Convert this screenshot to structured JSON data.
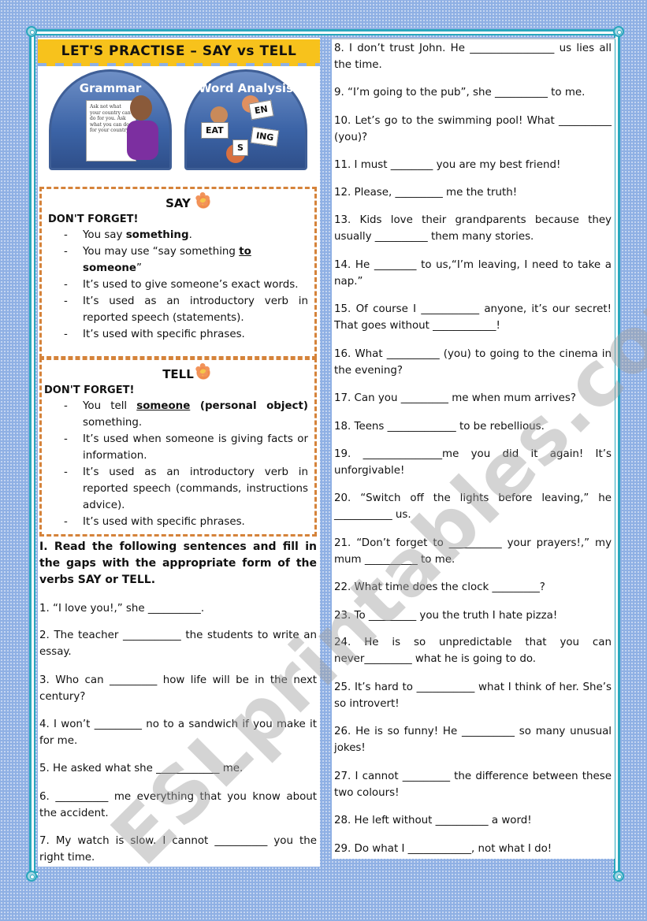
{
  "title": "LET'S PRACTISE – SAY vs TELL",
  "images": {
    "grammar_label": "Grammar",
    "grammar_card_text": "Ask not what your country can do for you. Ask what you can do for your country.",
    "word_analysis_label": "Word Analysis",
    "word_cards": [
      "EAT",
      "ING",
      "EN",
      "S"
    ]
  },
  "say_box": {
    "heading": "SAY",
    "reminder": "DON'T FORGET!",
    "rules": [
      {
        "pre": "You say ",
        "bold": "something",
        "post": "."
      },
      {
        "pre": "You may use “say something ",
        "underline_bold": "to",
        "bold": " someone",
        "post": "”"
      },
      {
        "pre": "It’s used to give someone’s exact words."
      },
      {
        "pre": "It’s used as an introductory verb in reported speech (statements)."
      },
      {
        "pre": "It’s used with specific phrases."
      }
    ]
  },
  "tell_box": {
    "heading": "TELL",
    "reminder": "DON'T FORGET!",
    "rules": [
      {
        "pre": "You tell ",
        "underline_bold": "someone",
        "bold": " (personal object)",
        "post": " something."
      },
      {
        "pre": "It’s used when someone is giving facts or information."
      },
      {
        "pre": "It’s used as an introductory verb in reported speech (commands, instructions advice)."
      },
      {
        "pre": "It’s used with specific phrases."
      }
    ]
  },
  "instructions": "I. Read the following sentences and fill in the gaps with the appropriate form of the verbs SAY or TELL.",
  "questions": [
    "1. “I love you!,” she __________.",
    "2. The teacher ___________ the students to write an essay.",
    "3. Who can _________ how life will be in the next century?",
    "4. I won’t _________ no to a sandwich if you make it for me.",
    "5. He asked what she ____________ me.",
    "6. __________ me everything that you know about the accident.",
    "7. My watch is slow. I cannot __________ you the right time.",
    "8. I don’t trust John. He ________________ us lies all the time.",
    "9. “I’m going to the pub”, she __________ to me.",
    "10. Let’s go to the swimming pool! What __________ (you)?",
    "11. I must ________ you are my best friend!",
    "12. Please, _________ me the truth!",
    "13. Kids love their grandparents because they usually __________ them many stories.",
    "14. He ________ to us,“I’m leaving, I need to take a nap.”",
    "15. Of course I ___________ anyone, it’s our secret! That goes without ____________!",
    "16. What __________ (you) to going to the cinema in the evening?",
    "17. Can you _________ me when mum arrives?",
    "18. Teens _____________ to be rebellious.",
    "19. _______________me you did it again! It’s unforgivable!",
    "20. “Switch off the lights before leaving,” he ___________ us.",
    "21. “Don’t forget to __________ your prayers!,” my mum __________ to me.",
    "22. What time does the clock _________?",
    "23. To _________ you the truth I hate pizza!",
    "24. He is so unpredictable that you can never_________ what he is going to do.",
    "25. It’s hard to ___________ what I think of her. She’s so introvert!",
    "26. He is so funny! He __________ so many unusual jokes!",
    "27. I cannot _________ the difference between these two colours!",
    "28. He left without __________ a word!",
    "29. Do what I ____________, not what I do!"
  ],
  "watermark": "ESLprintables.com",
  "colors": {
    "background": "#8fb0e4",
    "frame": "#2aa7bd",
    "banner": "#f7c21c",
    "box_border": "#d5833a"
  }
}
